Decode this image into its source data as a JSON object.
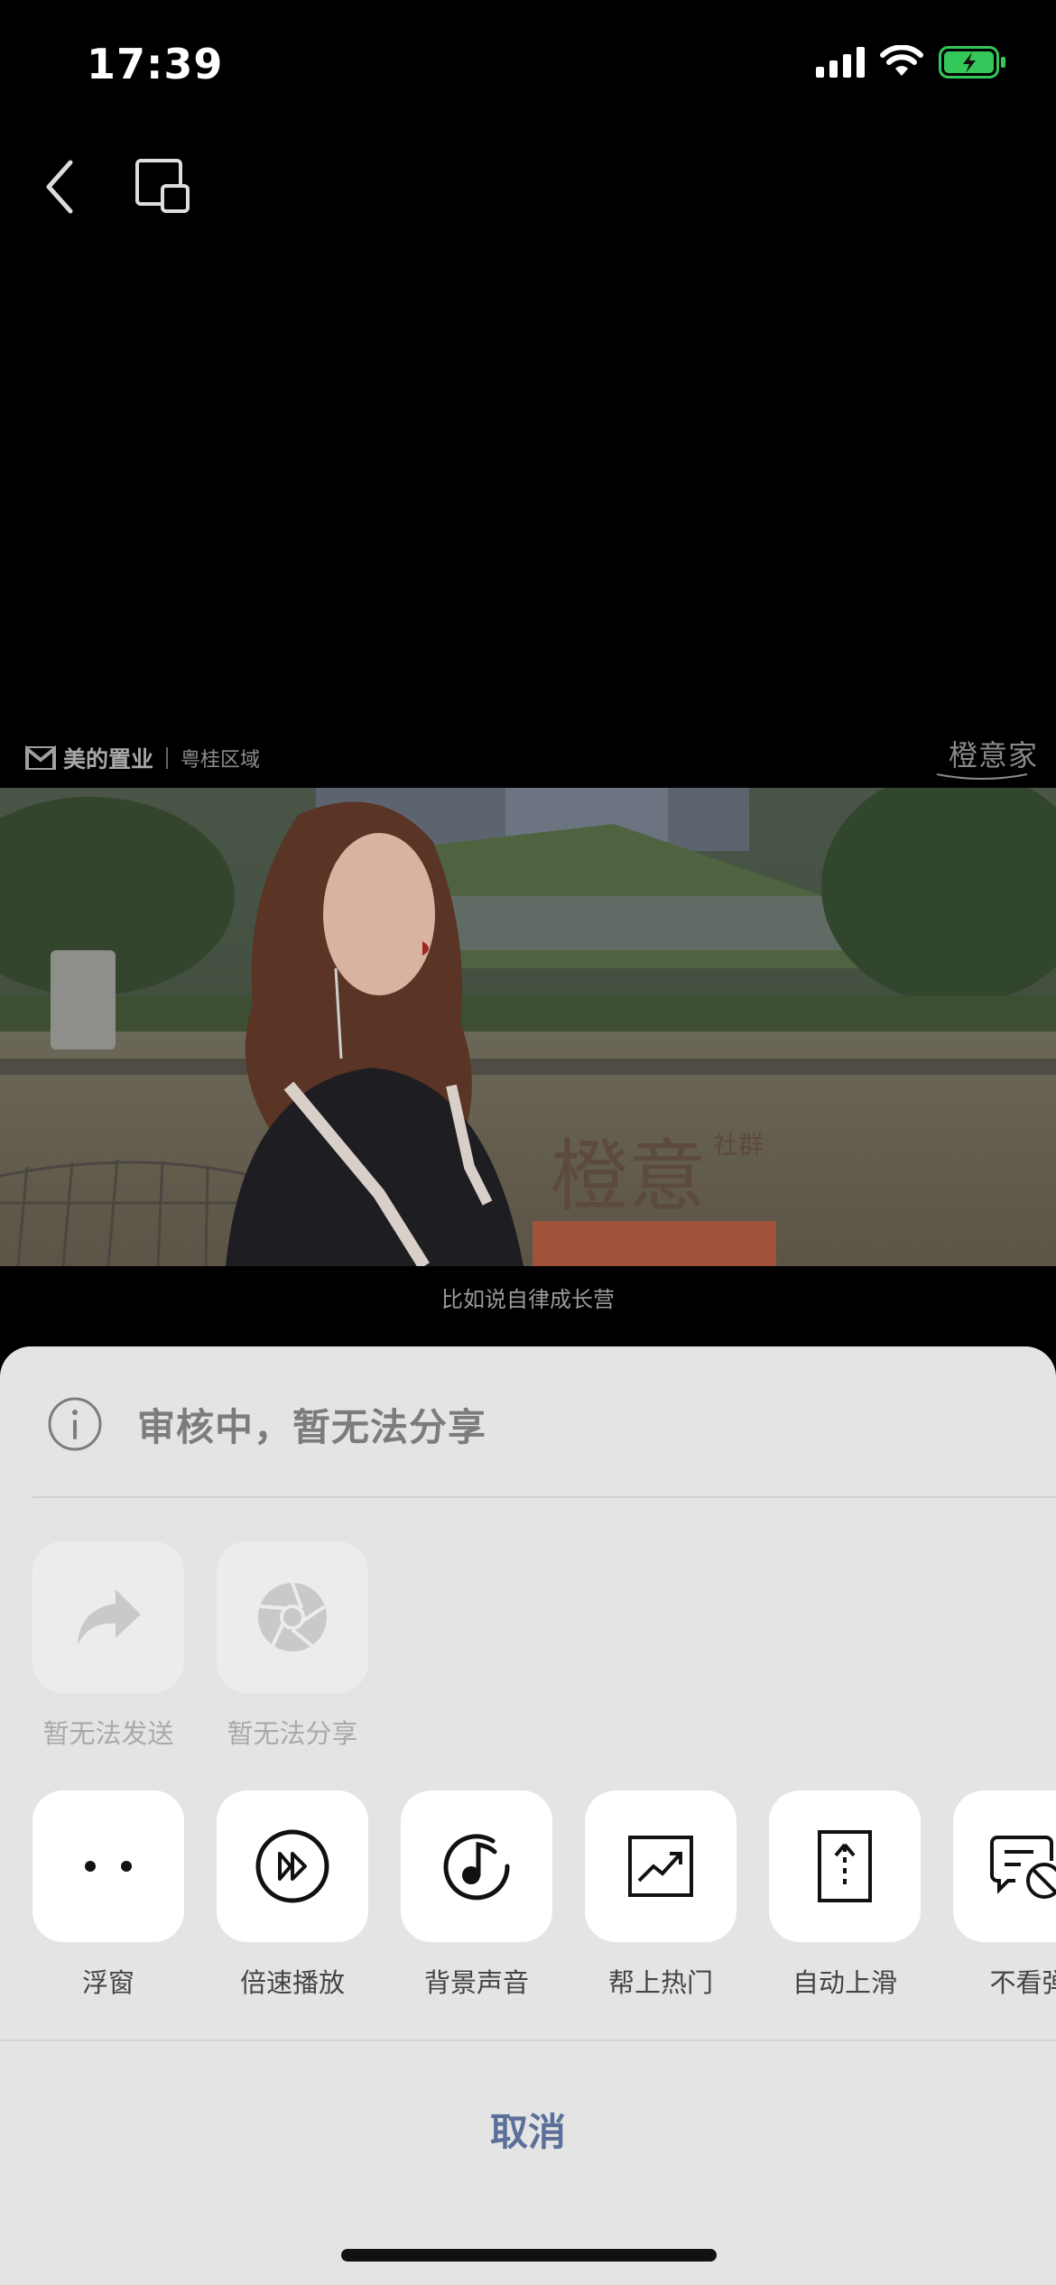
{
  "status_bar": {
    "time": "17:39",
    "battery_color": "#34c759"
  },
  "nav": {
    "back_icon": "chevron-left-icon",
    "float_icon": "floating-window-icon"
  },
  "video": {
    "brand_name": "美的置业",
    "brand_region": "粤桂区域",
    "watermark": "橙意家",
    "subtitle": "比如说自律成长营",
    "scene_sign": "橙意",
    "scene_sign_side": "社群"
  },
  "sheet": {
    "notice": "审核中，暂无法分享",
    "disabled_actions": [
      {
        "label": "暂无法发送",
        "icon": "share-arrow-icon"
      },
      {
        "label": "暂无法分享",
        "icon": "aperture-icon"
      }
    ],
    "actions": [
      {
        "label": "浮窗",
        "icon": "two-dots-icon"
      },
      {
        "label": "倍速播放",
        "icon": "fast-forward-circle-icon"
      },
      {
        "label": "背景声音",
        "icon": "music-note-circle-icon"
      },
      {
        "label": "帮上热门",
        "icon": "trending-up-icon"
      },
      {
        "label": "自动上滑",
        "icon": "auto-scroll-up-icon"
      },
      {
        "label": "不看弹",
        "icon": "no-danmaku-icon"
      }
    ],
    "cancel": "取消",
    "accent_color": "#5a6f9a"
  }
}
